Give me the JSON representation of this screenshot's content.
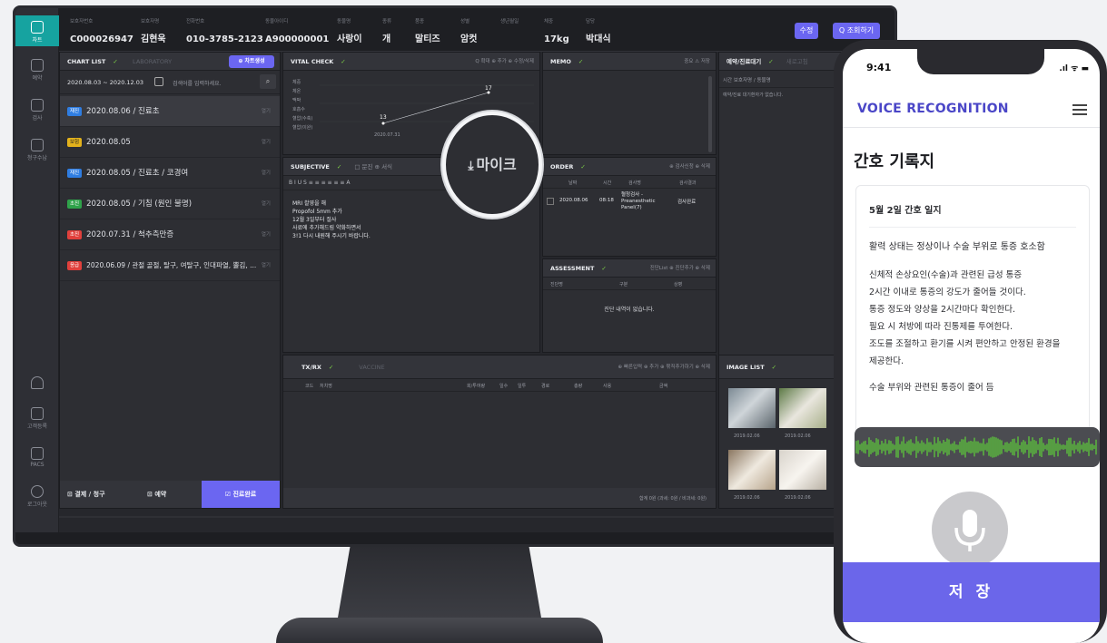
{
  "nav": {
    "items": [
      {
        "label": "차트",
        "active": true
      },
      {
        "label": "예약"
      },
      {
        "label": "검사"
      },
      {
        "label": "청구수납"
      }
    ],
    "bottom": [
      {
        "label": ""
      },
      {
        "label": "고객등록"
      },
      {
        "label": "PACS"
      },
      {
        "label": "로그아웃"
      }
    ]
  },
  "patient": {
    "fields": [
      {
        "label": "보호자번호",
        "value": "C000026947"
      },
      {
        "label": "보호자명",
        "value": "김현욱"
      },
      {
        "label": "전화번호",
        "value": "010-3785-2123"
      },
      {
        "label": "동물아이디",
        "value": "A900000001"
      },
      {
        "label": "동물명",
        "value": "사랑이"
      },
      {
        "label": "종류",
        "value": "개"
      },
      {
        "label": "품종",
        "value": "말티즈"
      },
      {
        "label": "성별",
        "value": "암컷"
      },
      {
        "label": "생년월일",
        "value": ""
      },
      {
        "label": "체중",
        "value": "17kg"
      },
      {
        "label": "담당",
        "value": "박대식"
      }
    ],
    "edit_label": "수정",
    "search_label": "Q 조회하기"
  },
  "chart_list": {
    "title": "CHART LIST",
    "tab2": "LABORATORY",
    "new_button": "⊕ 차트생성",
    "date_range": "2020.08.03 ~ 2020.12.03",
    "search_placeholder": "검색어를 입력하세요.",
    "rows": [
      {
        "badge": "재진",
        "badge_color": "#2f7de1",
        "text": "2020.08.06 / 진료초",
        "more": "열기"
      },
      {
        "badge": "보험",
        "badge_color": "#e3b21c",
        "text": "2020.08.05",
        "more": "열기"
      },
      {
        "badge": "재진",
        "badge_color": "#2f7de1",
        "text": "2020.08.05 / 진료초 / 코경여",
        "more": "열기"
      },
      {
        "badge": "초진",
        "badge_color": "#2fa24a",
        "text": "2020.08.05 / 기침 (원인 불명)",
        "more": "열기"
      },
      {
        "badge": "초진",
        "badge_color": "#e0403c",
        "text": "2020.07.31 / 척추측만증",
        "more": "열기"
      },
      {
        "badge": "응급",
        "badge_color": "#e0403c",
        "text": "2020.06.09 / 관절 골절, 탈구, 여탈구, 인대파열, 뿔김, ...",
        "more": "열기"
      }
    ],
    "footer": {
      "pay": "결제 / 청구",
      "reserve": "예약",
      "done": "진료완료"
    }
  },
  "vital": {
    "title": "VITAL CHECK",
    "actions": "Q 확대  ⊕ 추가  ⊕ 수정/삭제",
    "rows": [
      "체중",
      "체온",
      "맥박",
      "호흡수",
      "혈압(수축)",
      "혈압(이완)"
    ],
    "point_a": "13",
    "point_b": "17",
    "date_tick": "2020.07.31"
  },
  "memo": {
    "title": "MEMO",
    "actions": "중요  ⚠ 저장"
  },
  "reservation": {
    "title": "예약/진료대기",
    "tab2": "새로고침",
    "cols": "시간   보호자명 / 동물명",
    "empty": "예약/진료 대기환자가 없습니다."
  },
  "subjective": {
    "title": "SUBJECTIVE",
    "tabs": "□ 문진  ⊕ 서식",
    "toolbar": "B  I  U  S  ≡  ≡  ≡  ≡  ≡  ≡  A",
    "lines": [
      "MRI 촬영을 해",
      "Propofol 5mm 추가",
      "12월 3일부터 절사",
      "사료에 추가해드림 약화하면서",
      "3!1 다시 내원해 주시기 바랍니다."
    ]
  },
  "mic_bubble": {
    "label": "마이크"
  },
  "order": {
    "title": "ORDER",
    "actions": "⊕ 검사신청  ⊕ 삭제",
    "cols": [
      "날짜",
      "시간",
      "검사명",
      "검사결과"
    ],
    "row": {
      "date": "2020.08.06",
      "time": "08:18",
      "name": "혈청검사 - Preanesthetic Panel(7)",
      "result": "검사완료"
    }
  },
  "assessment": {
    "title": "ASSESSMENT",
    "actions": "진단List  ⊕ 진단추가  ⊕ 삭제",
    "cols": [
      "진단명",
      "구분",
      "상병"
    ],
    "empty": "진단 내역이 없습니다."
  },
  "txrx": {
    "title": "TX/RX",
    "tab2": "VACCINE",
    "actions": "⊕ 빠른입력  ⊕ 추가  ⊕ 묶직추가하기  ⊕ 삭제",
    "cols": [
      "코드",
      "처치명",
      "회/투여량",
      "일수",
      "일투",
      "경로",
      "총량",
      "사용",
      "금액"
    ],
    "footer": "합계  0원 (과세: 0원 / 비과세: 0원)"
  },
  "image_list": {
    "title": "IMAGE LIST",
    "dates": [
      "2019.02.06",
      "2019.02.06",
      "2019.02.06",
      "2019.02.06"
    ]
  },
  "phone": {
    "time": "9:41",
    "status": ".ıl ᯤ ▬",
    "app_title": "VOICE RECOGNITION",
    "page_title": "간호 기록지",
    "note_title": "5월 2일 간호 일지",
    "note_lines": [
      "활력 상태는 정상이나 수술 부위로 통증 호소함",
      "신체적 손상요인(수술)과 관련된 급성 통증",
      "2시간 이내로 통증의 강도가 줄어들 것이다.",
      "통증 정도와 양상을 2시간마다 확인한다.",
      "필요 시 처방에 따라 진통제를 투여한다.",
      "조도를 조절하고 환기를 시켜 편안하고 안정된 환경을",
      "제공한다.",
      "수술 부위와 관련된 통증이 줄어 듬"
    ],
    "save_label": "저 장"
  }
}
